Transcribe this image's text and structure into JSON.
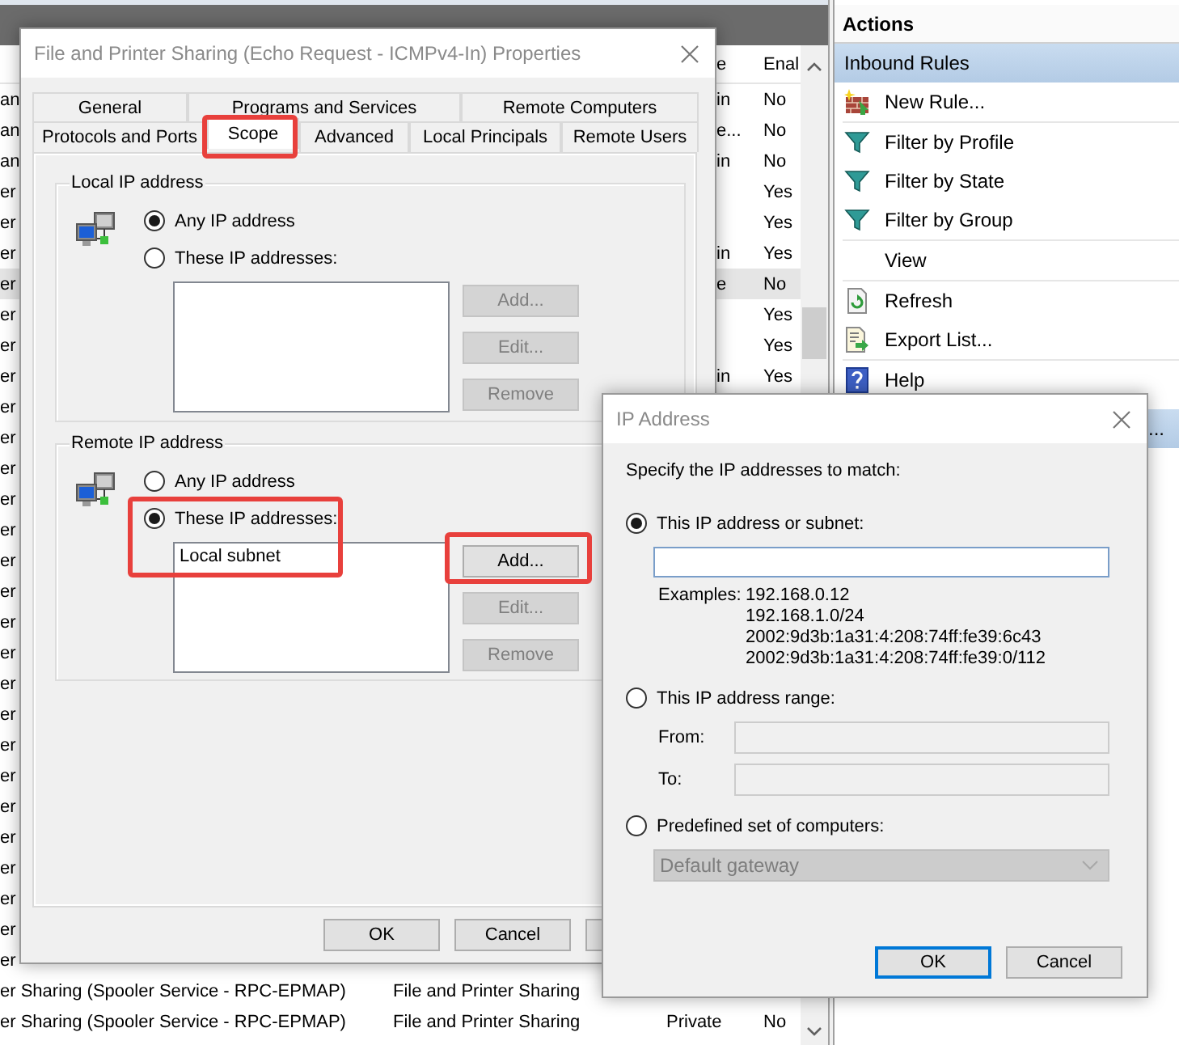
{
  "console": {
    "rules_table": {
      "header": {
        "profile_tail": "e",
        "enabled": "Enal"
      },
      "rows": [
        {
          "name": "an",
          "profile_tail": "in",
          "enabled": "No",
          "selected": false
        },
        {
          "name": "an",
          "profile_tail": "e...",
          "enabled": "No",
          "selected": false
        },
        {
          "name": "an",
          "profile_tail": "in",
          "enabled": "No",
          "selected": false
        },
        {
          "name": "er",
          "enabled": "Yes",
          "selected": false
        },
        {
          "name": "er",
          "enabled": "Yes",
          "selected": false
        },
        {
          "name": "er",
          "profile_tail": "in",
          "enabled": "Yes",
          "selected": false
        },
        {
          "name": "er",
          "profile_tail": "e",
          "enabled": "No",
          "selected": true
        },
        {
          "name": "er",
          "enabled": "Yes",
          "selected": false
        },
        {
          "name": "er",
          "enabled": "Yes",
          "selected": false
        },
        {
          "name": "er",
          "profile_tail": "in",
          "enabled": "Yes",
          "selected": false
        },
        {
          "name": "er",
          "selected": false
        },
        {
          "name": "er",
          "selected": false
        },
        {
          "name": "er",
          "selected": false
        },
        {
          "name": "er",
          "selected": false
        },
        {
          "name": "er",
          "selected": false
        },
        {
          "name": "er",
          "selected": false
        },
        {
          "name": "er",
          "selected": false
        },
        {
          "name": "er",
          "selected": false
        },
        {
          "name": "er",
          "selected": false
        },
        {
          "name": "er",
          "selected": false
        },
        {
          "name": "er",
          "selected": false
        },
        {
          "name": "er",
          "selected": false
        },
        {
          "name": "er",
          "selected": false
        },
        {
          "name": "er",
          "selected": false
        },
        {
          "name": "er",
          "selected": false
        },
        {
          "name": "er",
          "selected": false
        },
        {
          "name": "er",
          "selected": false
        },
        {
          "name": "er",
          "selected": false
        },
        {
          "name": "er",
          "selected": false
        },
        {
          "name": "er Sharing (Spooler Service - RPC-EPMAP)",
          "group": "File and Printer Sharing",
          "selected": false
        },
        {
          "name": "er Sharing (Spooler Service - RPC-EPMAP)",
          "group": "File and Printer Sharing",
          "profile": "Private",
          "enabled": "No",
          "selected": false
        }
      ]
    },
    "actions": {
      "title": "Actions",
      "sections": [
        {
          "kind": "header",
          "title": "Inbound Rules",
          "items": [
            {
              "kind": "new-rule",
              "label": "New Rule..."
            },
            {
              "kind": "filter",
              "label": "Filter by Profile"
            },
            {
              "kind": "filter",
              "label": "Filter by State"
            },
            {
              "kind": "filter",
              "label": "Filter by Group"
            },
            {
              "kind": "view",
              "label": "View"
            },
            {
              "kind": "refresh",
              "label": "Refresh"
            },
            {
              "kind": "export",
              "label": "Export List..."
            },
            {
              "kind": "help",
              "label": "Help"
            }
          ]
        },
        {
          "kind": "tail",
          "title": "..."
        }
      ]
    }
  },
  "properties_dialog": {
    "title": "File and Printer Sharing (Echo Request - ICMPv4-In) Properties",
    "tab_rows": [
      {
        "tabs": [
          {
            "label": "General",
            "selected": false,
            "highlighted": false
          },
          {
            "label": "Programs and Services",
            "selected": false,
            "highlighted": false
          },
          {
            "label": "Remote Computers",
            "selected": false,
            "highlighted": false
          }
        ]
      },
      {
        "tabs": [
          {
            "label": "Protocols and Ports",
            "selected": false,
            "highlighted": false
          },
          {
            "label": "Scope",
            "selected": true,
            "highlighted": true
          },
          {
            "label": "Advanced",
            "selected": false,
            "highlighted": false
          },
          {
            "label": "Local Principals",
            "selected": false,
            "highlighted": false
          },
          {
            "label": "Remote Users",
            "selected": false,
            "highlighted": false
          }
        ]
      }
    ],
    "groups": [
      {
        "title": "Local IP address",
        "highlighted": false,
        "options": [
          {
            "label": "Any IP address",
            "selected": true
          },
          {
            "label": "These IP addresses:",
            "selected": false
          }
        ],
        "buttons": [
          {
            "label": "Add...",
            "disabled": true,
            "highlighted": false
          },
          {
            "label": "Edit...",
            "disabled": true,
            "highlighted": false
          },
          {
            "label": "Remove",
            "disabled": true,
            "highlighted": false
          }
        ]
      },
      {
        "title": "Remote IP address",
        "highlighted": true,
        "options": [
          {
            "label": "Any IP address",
            "selected": false
          },
          {
            "label": "These IP addresses:",
            "selected": true
          }
        ],
        "addresses": [
          "Local subnet"
        ],
        "buttons": [
          {
            "label": "Add...",
            "disabled": false,
            "highlighted": true
          },
          {
            "label": "Edit...",
            "disabled": true,
            "highlighted": false
          },
          {
            "label": "Remove",
            "disabled": true,
            "highlighted": false
          }
        ]
      }
    ],
    "buttons": [
      {
        "label": "OK"
      },
      {
        "label": "Cancel"
      }
    ]
  },
  "ip_dialog": {
    "title": "IP Address",
    "prompt": "Specify the IP addresses to match:",
    "options": [
      {
        "kind": "subnet",
        "label": "This IP address or subnet:",
        "selected": true,
        "disabled": false,
        "examples_label": "Examples:",
        "examples": [
          "192.168.0.12",
          "192.168.1.0/24",
          "2002:9d3b:1a31:4:208:74ff:fe39:6c43",
          "2002:9d3b:1a31:4:208:74ff:fe39:0/112"
        ]
      },
      {
        "kind": "range",
        "label": "This IP address range:",
        "selected": false,
        "disabled": true,
        "from_label": "From:",
        "to_label": "To:"
      },
      {
        "kind": "predefined",
        "label": "Predefined set of computers:",
        "selected": false,
        "disabled": true,
        "value": "Default gateway"
      }
    ],
    "buttons": [
      {
        "label": "OK",
        "focused": true
      },
      {
        "label": "Cancel",
        "focused": false
      }
    ]
  }
}
